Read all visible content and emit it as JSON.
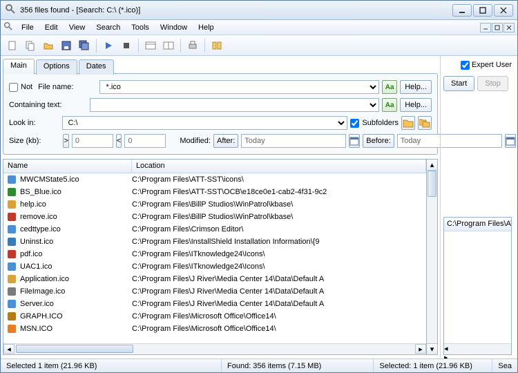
{
  "window": {
    "title": "356 files found - [Search: C:\\ (*.ico)]"
  },
  "menu": [
    "File",
    "Edit",
    "View",
    "Search",
    "Tools",
    "Window",
    "Help"
  ],
  "tabs": {
    "main": "Main",
    "options": "Options",
    "dates": "Dates"
  },
  "form": {
    "not_label": "Not",
    "not_checked": false,
    "filename_label": "File name:",
    "filename_value": "*.ico",
    "containing_label": "Containing text:",
    "containing_value": "",
    "lookin_label": "Look in:",
    "lookin_value": "C:\\",
    "subfolders_label": "Subfolders",
    "subfolders_checked": true,
    "size_label": "Size (kb):",
    "size_min": "0",
    "size_max": "0",
    "gt": ">",
    "lt": "<",
    "modified_label": "Modified:",
    "after_label": "After:",
    "after_value": "Today",
    "before_label": "Before:",
    "before_value": "Today",
    "help_label": "Help...",
    "aa": "Aa"
  },
  "right": {
    "expert_label": "Expert User",
    "expert_checked": true,
    "start": "Start",
    "stop": "Stop"
  },
  "columns": {
    "name": "Name",
    "location": "Location"
  },
  "rows": [
    {
      "icon": "#4a90d9",
      "name": "MWCMState5.ico",
      "loc": "C:\\Program Files\\ATT-SST\\icons\\"
    },
    {
      "icon": "#2e8b2e",
      "name": "BS_Blue.ico",
      "loc": "C:\\Program Files\\ATT-SST\\OCB\\e18ce0e1-cab2-4f31-9c2"
    },
    {
      "icon": "#d9a33a",
      "name": "help.ico",
      "loc": "C:\\Program Files\\BillP Studios\\WinPatrol\\kbase\\"
    },
    {
      "icon": "#c0392b",
      "name": "remove.ico",
      "loc": "C:\\Program Files\\BillP Studios\\WinPatrol\\kbase\\"
    },
    {
      "icon": "#4a90d9",
      "name": "cedttype.ico",
      "loc": "C:\\Program Files\\Crimson Editor\\"
    },
    {
      "icon": "#3a7ab8",
      "name": "Uninst.ico",
      "loc": "C:\\Program Files\\InstallShield Installation Information\\{9"
    },
    {
      "icon": "#c0392b",
      "name": "pdf.ico",
      "loc": "C:\\Program Files\\ITknowledge24\\Icons\\"
    },
    {
      "icon": "#4a90d9",
      "name": "UAC1.ico",
      "loc": "C:\\Program Files\\ITknowledge24\\Icons\\"
    },
    {
      "icon": "#d9a33a",
      "name": "Application.ico",
      "loc": "C:\\Program Files\\J River\\Media Center 14\\Data\\Default A"
    },
    {
      "icon": "#7a7a7a",
      "name": "FileImage.ico",
      "loc": "C:\\Program Files\\J River\\Media Center 14\\Data\\Default A"
    },
    {
      "icon": "#4a90d9",
      "name": "Server.ico",
      "loc": "C:\\Program Files\\J River\\Media Center 14\\Data\\Default A"
    },
    {
      "icon": "#b37d12",
      "name": "GRAPH.ICO",
      "loc": "C:\\Program Files\\Microsoft Office\\Office14\\"
    },
    {
      "icon": "#e67e22",
      "name": "MSN.ICO",
      "loc": "C:\\Program Files\\Microsoft Office\\Office14\\"
    }
  ],
  "preview": {
    "path": "C:\\Program Files\\ATT-SST\\icons\\MWCMS"
  },
  "status": {
    "selected_left": "Selected 1 item (21.96 KB)",
    "found": "Found: 356 items (7.15 MB)",
    "selected_right": "Selected: 1 item (21.96 KB)",
    "tail": "Sea"
  }
}
